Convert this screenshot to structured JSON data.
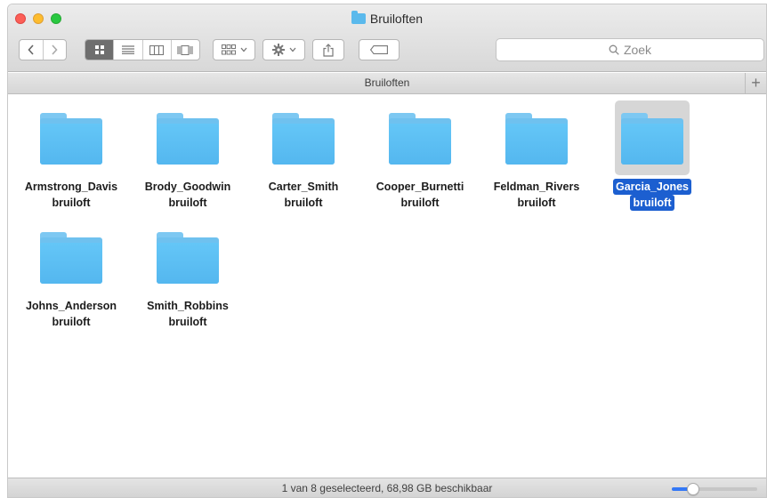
{
  "window": {
    "title": "Bruiloften"
  },
  "toolbar": {
    "search_placeholder": "Zoek"
  },
  "pathbar": {
    "label": "Bruiloften"
  },
  "folders": [
    {
      "line1": "Armstrong_Davis",
      "line2": "bruiloft",
      "selected": false
    },
    {
      "line1": "Brody_Goodwin",
      "line2": "bruiloft",
      "selected": false
    },
    {
      "line1": "Carter_Smith",
      "line2": "bruiloft",
      "selected": false
    },
    {
      "line1": "Cooper_Burnetti",
      "line2": "bruiloft",
      "selected": false
    },
    {
      "line1": "Feldman_Rivers",
      "line2": "bruiloft",
      "selected": false
    },
    {
      "line1": "Garcia_Jones",
      "line2": "bruiloft",
      "selected": true
    },
    {
      "line1": "Johns_Anderson",
      "line2": "bruiloft",
      "selected": false
    },
    {
      "line1": "Smith_Robbins",
      "line2": "bruiloft",
      "selected": false
    }
  ],
  "status": {
    "text": "1 van 8 geselecteerd, 68,98 GB beschikbaar"
  },
  "icon_size_slider": {
    "level": 0.25
  },
  "colors": {
    "folder": "#5ab9ec",
    "selection": "#1c5fd0",
    "accent": "#3478f6"
  }
}
